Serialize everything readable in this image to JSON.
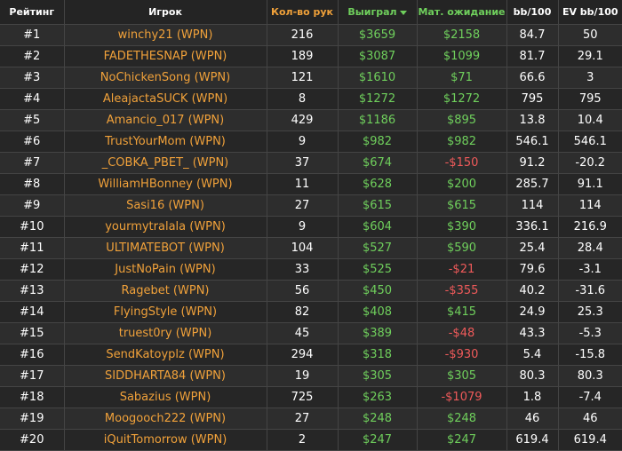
{
  "header": {
    "rank": "Рейтинг",
    "player": "Игрок",
    "hands": "Кол-во рук",
    "won": "Выиграл",
    "ev": "Мат. ожидание",
    "bb100": "bb/100",
    "evbb100": "EV bb/100"
  },
  "colors": {
    "accent_orange": "#f0a13a",
    "positive_green": "#6fcf5c",
    "negative_red": "#ef5a5a"
  },
  "rows": [
    {
      "rank": "#1",
      "player": "winchy21 (WPN)",
      "hands": "216",
      "won": "$3659",
      "ev": "$2158",
      "bb100": "84.7",
      "evbb100": "50"
    },
    {
      "rank": "#2",
      "player": "FADETHESNAP (WPN)",
      "hands": "189",
      "won": "$3087",
      "ev": "$1099",
      "bb100": "81.7",
      "evbb100": "29.1"
    },
    {
      "rank": "#3",
      "player": "NoChickenSong (WPN)",
      "hands": "121",
      "won": "$1610",
      "ev": "$71",
      "bb100": "66.6",
      "evbb100": "3"
    },
    {
      "rank": "#4",
      "player": "AleajactaSUCK (WPN)",
      "hands": "8",
      "won": "$1272",
      "ev": "$1272",
      "bb100": "795",
      "evbb100": "795"
    },
    {
      "rank": "#5",
      "player": "Amancio_017 (WPN)",
      "hands": "429",
      "won": "$1186",
      "ev": "$895",
      "bb100": "13.8",
      "evbb100": "10.4"
    },
    {
      "rank": "#6",
      "player": "TrustYourMom (WPN)",
      "hands": "9",
      "won": "$982",
      "ev": "$982",
      "bb100": "546.1",
      "evbb100": "546.1"
    },
    {
      "rank": "#7",
      "player": "_COBKA_PBET_ (WPN)",
      "hands": "37",
      "won": "$674",
      "ev": "-$150",
      "bb100": "91.2",
      "evbb100": "-20.2"
    },
    {
      "rank": "#8",
      "player": "WilliamHBonney (WPN)",
      "hands": "11",
      "won": "$628",
      "ev": "$200",
      "bb100": "285.7",
      "evbb100": "91.1"
    },
    {
      "rank": "#9",
      "player": "Sasi16 (WPN)",
      "hands": "27",
      "won": "$615",
      "ev": "$615",
      "bb100": "114",
      "evbb100": "114"
    },
    {
      "rank": "#10",
      "player": "yourmytralala (WPN)",
      "hands": "9",
      "won": "$604",
      "ev": "$390",
      "bb100": "336.1",
      "evbb100": "216.9"
    },
    {
      "rank": "#11",
      "player": "ULTIMATEBOT (WPN)",
      "hands": "104",
      "won": "$527",
      "ev": "$590",
      "bb100": "25.4",
      "evbb100": "28.4"
    },
    {
      "rank": "#12",
      "player": "JustNoPain (WPN)",
      "hands": "33",
      "won": "$525",
      "ev": "-$21",
      "bb100": "79.6",
      "evbb100": "-3.1"
    },
    {
      "rank": "#13",
      "player": "Ragebet (WPN)",
      "hands": "56",
      "won": "$450",
      "ev": "-$355",
      "bb100": "40.2",
      "evbb100": "-31.6"
    },
    {
      "rank": "#14",
      "player": "FlyingStyle (WPN)",
      "hands": "82",
      "won": "$408",
      "ev": "$415",
      "bb100": "24.9",
      "evbb100": "25.3"
    },
    {
      "rank": "#15",
      "player": "truest0ry (WPN)",
      "hands": "45",
      "won": "$389",
      "ev": "-$48",
      "bb100": "43.3",
      "evbb100": "-5.3"
    },
    {
      "rank": "#16",
      "player": "SendKatoyplz (WPN)",
      "hands": "294",
      "won": "$318",
      "ev": "-$930",
      "bb100": "5.4",
      "evbb100": "-15.8"
    },
    {
      "rank": "#17",
      "player": "SIDDHARTA84 (WPN)",
      "hands": "19",
      "won": "$305",
      "ev": "$305",
      "bb100": "80.3",
      "evbb100": "80.3"
    },
    {
      "rank": "#18",
      "player": "Sabazius (WPN)",
      "hands": "725",
      "won": "$263",
      "ev": "-$1079",
      "bb100": "1.8",
      "evbb100": "-7.4"
    },
    {
      "rank": "#19",
      "player": "Moogooch222 (WPN)",
      "hands": "27",
      "won": "$248",
      "ev": "$248",
      "bb100": "46",
      "evbb100": "46"
    },
    {
      "rank": "#20",
      "player": "iQuitTomorrow (WPN)",
      "hands": "2",
      "won": "$247",
      "ev": "$247",
      "bb100": "619.4",
      "evbb100": "619.4"
    }
  ]
}
